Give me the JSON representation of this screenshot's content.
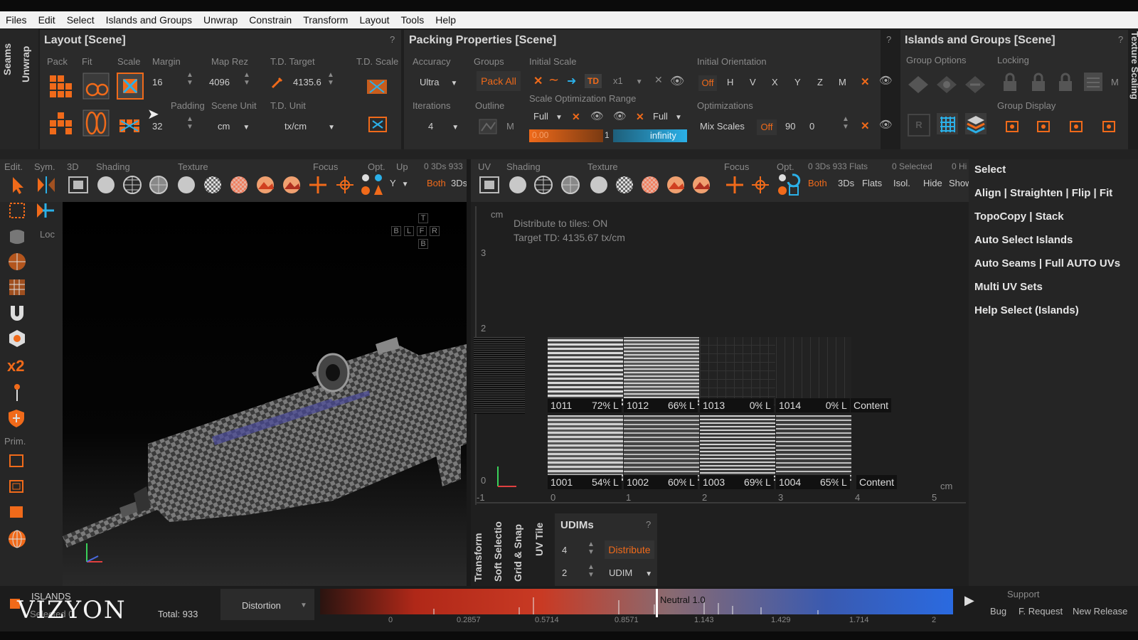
{
  "menu": [
    "Files",
    "Edit",
    "Select",
    "Islands and Groups",
    "Unwrap",
    "Constrain",
    "Transform",
    "Layout",
    "Tools",
    "Help"
  ],
  "side_tabs": {
    "seams": "Seams",
    "unwrap": "Unwrap",
    "texture_scaling": "Texture Scaling"
  },
  "layout_panel": {
    "title": "Layout [Scene]",
    "help": "?",
    "pack": "Pack",
    "fit": "Fit",
    "scale": "Scale",
    "margin": "Margin",
    "margin_value": "16",
    "map_rez": "Map Rez",
    "map_rez_value": "4096",
    "td_target": "T.D. Target",
    "td_target_value": "4135.6",
    "td_scale": "T.D. Scale",
    "padding": "Padding",
    "padding_value": "32",
    "scene_unit": "Scene Unit",
    "scene_unit_value": "cm",
    "td_unit": "T.D. Unit",
    "td_unit_value": "tx/cm"
  },
  "packing_panel": {
    "title": "Packing Properties [Scene]",
    "help": "?",
    "accuracy": "Accuracy",
    "accuracy_value": "Ultra",
    "groups": "Groups",
    "pack_all": "Pack All",
    "iterations": "Iterations",
    "iterations_value": "4",
    "outline": "Outline",
    "outline_m": "M",
    "initial_scale": "Initial Scale",
    "td": "TD",
    "x1": "x1",
    "scale_opt_range": "Scale Optimization Range",
    "full_a": "Full",
    "full_b": "Full",
    "range_min": "0.00",
    "range_mid": "1",
    "range_max": "infinity",
    "initial_orientation": "Initial Orientation",
    "orient_buttons": [
      "Off",
      "H",
      "V",
      "X",
      "Y",
      "Z",
      "M"
    ],
    "optimizations": "Optimizations",
    "mix_scales": "Mix Scales",
    "mix_off": "Off",
    "deg": "90",
    "zero": "0"
  },
  "islands_panel": {
    "title": "Islands and Groups [Scene]",
    "help": "?",
    "group_options": "Group Options",
    "locking": "Locking",
    "locking_m": "M",
    "group_display": "Group Display",
    "r": "R"
  },
  "viewport3d": {
    "edit": "Edit.",
    "sym": "Sym.",
    "3d": "3D",
    "shading": "Shading",
    "texture": "Texture",
    "focus": "Focus",
    "opt": "Opt.",
    "up": "Up",
    "stats": "0 3Ds 933",
    "y": "Y",
    "both": "Both",
    "threeds": "3Ds",
    "loc": "Loc",
    "prim": "Prim.",
    "x2": "x2",
    "gizmo": [
      "T",
      "B",
      "L",
      "F",
      "R",
      "B"
    ]
  },
  "uv_view": {
    "uv": "UV",
    "shading": "Shading",
    "texture": "Texture",
    "focus": "Focus",
    "opt": "Opt.",
    "stats": "0 3Ds 933 Flats",
    "selected": "0 Selected",
    "hidden": "0 Hi",
    "both": "Both",
    "threeds": "3Ds",
    "flats": "Flats",
    "isol": "Isol.",
    "hide": "Hide",
    "show": "Show",
    "cm_top": "cm",
    "cm_right": "cm",
    "info1": "Distribute to tiles: ON",
    "info2": "Target TD: 4135.67 tx/cm",
    "y_ticks": [
      "3",
      "2",
      "0"
    ],
    "x_ticks": [
      "-1",
      "0",
      "1",
      "2",
      "3",
      "4",
      "5"
    ],
    "tiles_top": [
      {
        "id": "1011",
        "pct": "72%",
        "l": "L"
      },
      {
        "id": "1012",
        "pct": "66%",
        "l": "L"
      },
      {
        "id": "1013",
        "pct": "0%",
        "l": "L"
      },
      {
        "id": "1014",
        "pct": "0%",
        "l": "L"
      }
    ],
    "tiles_bottom": [
      {
        "id": "1001",
        "pct": "54%",
        "l": "L"
      },
      {
        "id": "1002",
        "pct": "60%",
        "l": "L"
      },
      {
        "id": "1003",
        "pct": "69%",
        "l": "L"
      },
      {
        "id": "1004",
        "pct": "65%",
        "l": "L"
      }
    ],
    "content": "Content"
  },
  "udims": {
    "tabs": [
      "Transform",
      "Soft Selectio",
      "Grid & Snap",
      "UV Tile"
    ],
    "title": "UDIMs",
    "help": "?",
    "val1": "4",
    "val2": "2",
    "distribute": "Distribute",
    "udim": "UDIM"
  },
  "select_menu": [
    "Select",
    "Align | Straighten | Flip | Fit",
    "TopoCopy | Stack",
    "Auto Select Islands",
    "Auto Seams | Full AUTO UVs",
    "Multi UV Sets",
    "Help Select (Islands)"
  ],
  "status": {
    "islands": "ISLANDS",
    "logo": "VIZYON",
    "selected": "Selected 0",
    "total": "Total: 933",
    "mode": "Distortion",
    "neutral": "Neutral 1.0",
    "ticks": [
      "0",
      "0.2857",
      "0.5714",
      "0.8571",
      "1.143",
      "1.429",
      "1.714",
      "2"
    ],
    "support": "Support",
    "bug": "Bug",
    "request": "F. Request",
    "release": "New Release"
  },
  "colors": {
    "accent": "#f06a1a",
    "blue": "#2bb0e8",
    "panel": "#2b2b2b"
  }
}
